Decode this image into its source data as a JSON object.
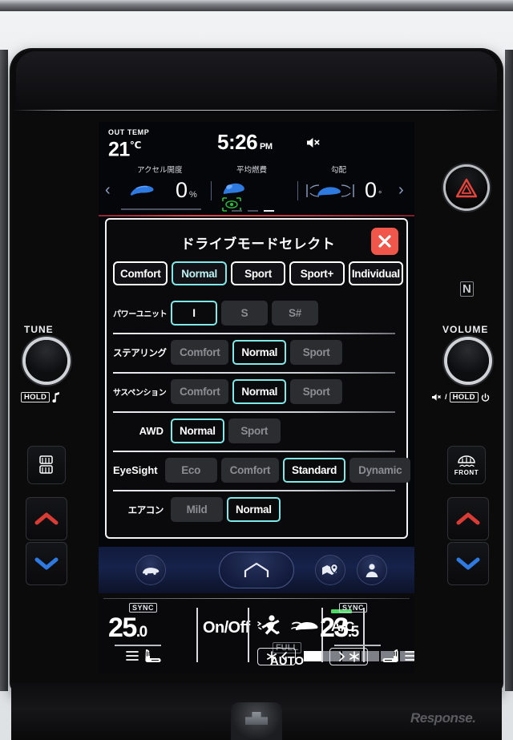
{
  "status_bar": {
    "out_temp_label": "OUT TEMP",
    "out_temp_value": "21",
    "out_temp_unit": "℃",
    "clock_time": "5:26",
    "clock_meridiem": "PM",
    "mute_icon": "speaker-mute-icon"
  },
  "info_strip": {
    "gauges": [
      {
        "caption": "アクセル開度",
        "value": "0",
        "unit": "%",
        "icon": "accel-pedal-icon"
      },
      {
        "caption": "平均燃費",
        "value": "",
        "unit": "",
        "icon": "fuel-car-icon"
      },
      {
        "caption": "勾配",
        "value": "0",
        "unit": "°",
        "icon": "incline-car-icon"
      }
    ],
    "prev_arrow": "‹",
    "next_arrow": "›",
    "eyesight_icon": "eyesight-green-icon",
    "page_dots": [
      false,
      false,
      true
    ]
  },
  "dialog": {
    "title": "ドライブモードセレクト",
    "close_icon": "close-x-icon",
    "close_color": "#f0564a",
    "accent_color": "#7fe8e8",
    "modes": [
      {
        "label": "Comfort",
        "selected": false
      },
      {
        "label": "Normal",
        "selected": true
      },
      {
        "label": "Sport",
        "selected": false
      },
      {
        "label": "Sport+",
        "selected": false
      },
      {
        "label": "Individual",
        "selected": false
      }
    ],
    "rows": [
      {
        "label": "パワーユニット",
        "label_style": "tight",
        "options": [
          {
            "label": "I",
            "selected": true
          },
          {
            "label": "S",
            "selected": false
          },
          {
            "label": "S#",
            "selected": false
          }
        ]
      },
      {
        "label": "ステアリング",
        "label_style": "jp",
        "options": [
          {
            "label": "Comfort",
            "selected": false
          },
          {
            "label": "Normal",
            "selected": true
          },
          {
            "label": "Sport",
            "selected": false
          }
        ]
      },
      {
        "label": "サスペンション",
        "label_style": "tight",
        "options": [
          {
            "label": "Comfort",
            "selected": false
          },
          {
            "label": "Normal",
            "selected": true
          },
          {
            "label": "Sport",
            "selected": false
          }
        ]
      },
      {
        "label": "AWD",
        "label_style": "en",
        "options": [
          {
            "label": "Normal",
            "selected": true
          },
          {
            "label": "Sport",
            "selected": false
          }
        ]
      },
      {
        "label": "EyeSight",
        "label_style": "en",
        "options": [
          {
            "label": "Eco",
            "selected": false
          },
          {
            "label": "Comfort",
            "selected": false
          },
          {
            "label": "Standard",
            "selected": true
          },
          {
            "label": "Dynamic",
            "selected": false
          }
        ]
      },
      {
        "label": "エアコン",
        "label_style": "jp",
        "options": [
          {
            "label": "Mild",
            "selected": false
          },
          {
            "label": "Normal",
            "selected": true
          }
        ]
      }
    ]
  },
  "dock": {
    "items": [
      {
        "icon": "car-icon",
        "name": "vehicle"
      },
      {
        "icon": "home-icon",
        "name": "home"
      },
      {
        "icon": "map-pin-icon",
        "name": "navigation"
      },
      {
        "icon": "person-icon",
        "name": "profile"
      }
    ]
  },
  "climate": {
    "left": {
      "sync_label": "SYNC",
      "temp_whole": "25",
      "temp_decimal": ".0",
      "seat_icon": "seat-heater-icon",
      "level_icon": "level-bars-icon"
    },
    "right": {
      "sync_label": "SYNC",
      "temp_whole": "23",
      "temp_decimal": ".5",
      "seat_icon": "seat-heater-icon",
      "level_icon": "level-bars-icon"
    },
    "onoff_label": "On/Off",
    "ac_label": "A/C",
    "ac_on": true,
    "full_label": "FULL",
    "auto_label": "AUTO",
    "mode_icons": [
      "seat-airflow-icon",
      "defrost-airflow-icon"
    ],
    "fan_down_icon": "fan-decrease-icon",
    "fan_up_icon": "fan-increase-icon",
    "fan_level": 1,
    "fan_steps": 7
  },
  "hard_controls": {
    "left": {
      "knob_label": "TUNE",
      "hold_label": "HOLD",
      "hold_icon": "music-note-icon",
      "defog_icon": "rear-defogger-icon",
      "up_icon": "temp-up-arrow-icon",
      "down_icon": "temp-down-arrow-icon"
    },
    "right": {
      "knob_label": "VOLUME",
      "mute_icon": "speaker-mute-icon",
      "hold_label": "HOLD",
      "power_icon": "power-icon",
      "defrost_icon": "front-defroster-icon",
      "defrost_label": "FRONT",
      "up_icon": "temp-up-arrow-icon",
      "down_icon": "temp-down-arrow-icon"
    },
    "hazard_icon": "hazard-triangle-icon",
    "nfc_label": "N"
  },
  "watermark": {
    "text": "Response."
  }
}
